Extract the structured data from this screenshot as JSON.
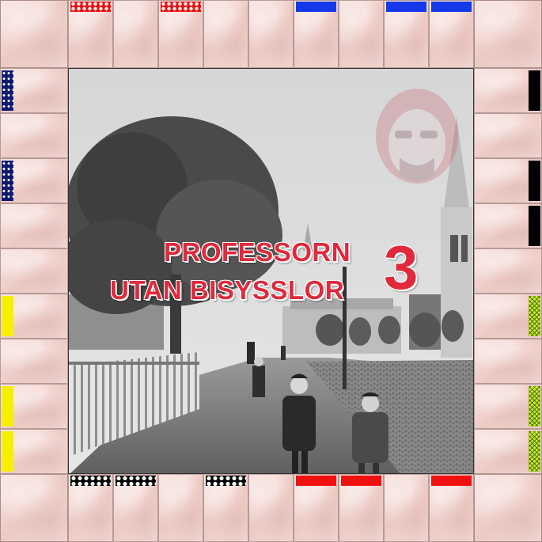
{
  "game": {
    "title_line1": "PROFESSORN",
    "title_line2": "UTAN BISYSSLOR",
    "title_number": "3"
  },
  "colors": {
    "blue": "#1538e8",
    "red": "#f01010",
    "black": "#000000",
    "yellow": "#f5f000",
    "green": "#c8e830",
    "navy": "#101a70",
    "title_red": "#e02a3c"
  },
  "board": {
    "top": [
      "red-dots",
      "none",
      "red-dots",
      "none",
      "none",
      "blue",
      "none",
      "blue",
      "blue"
    ],
    "bottom": [
      "black-dots",
      "black-dots",
      "none",
      "black-dots",
      "none",
      "red",
      "red",
      "none",
      "red"
    ],
    "left": [
      "navy-stars",
      "none",
      "navy-stars",
      "none",
      "none",
      "yellow",
      "none",
      "yellow",
      "yellow"
    ],
    "right": [
      "black",
      "none",
      "black",
      "black",
      "none",
      "green-check",
      "none",
      "green-check",
      "green-check"
    ]
  }
}
